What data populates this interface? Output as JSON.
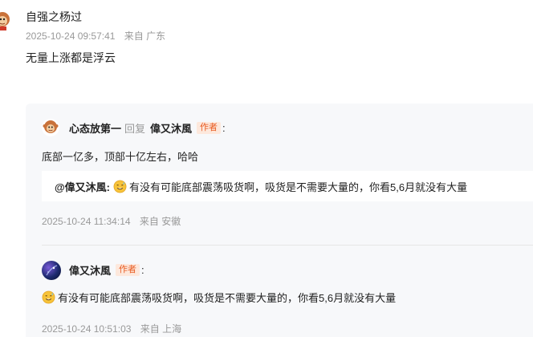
{
  "main_comment": {
    "username": "自强之杨过",
    "timestamp": "2025-10-24 09:57:41",
    "location": "来自 广东",
    "content": "无量上涨都是浮云",
    "avatar_icon": "monkey-avatar-icon"
  },
  "replies": [
    {
      "username": "心态放第一",
      "verb": "回复",
      "target_user": "偉又沐風",
      "target_badge": "作者",
      "colon": ":",
      "content": "底部一亿多，顶部十亿左右，哈哈",
      "quote": {
        "user": "@偉又沐風:",
        "emoji": "sweat-smile-emoji",
        "text": "有没有可能底部震荡吸货啊，吸货是不需要大量的，你看5,6月就没有大量"
      },
      "timestamp": "2025-10-24 11:34:14",
      "location": "来自 安徽",
      "avatar_icon": "monkey-avatar-icon"
    },
    {
      "username": "偉又沐風",
      "badge": "作者",
      "colon": ":",
      "emoji": "sweat-smile-emoji",
      "content": "有没有可能底部震荡吸货啊，吸货是不需要大量的，你看5,6月就没有大量",
      "timestamp": "2025-10-24 10:51:03",
      "location": "来自 上海",
      "avatar_icon": "galaxy-avatar-icon"
    }
  ],
  "colors": {
    "badge_text": "#e85a20",
    "badge_bg": "#fde8dc",
    "meta_text": "#999999",
    "panel_bg": "#f7f8fa"
  }
}
